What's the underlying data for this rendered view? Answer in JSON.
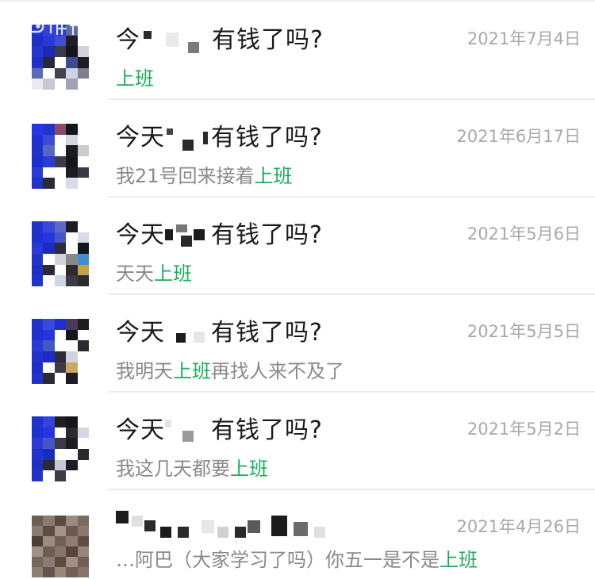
{
  "watermark": {
    "icon": "game-watermark-logo"
  },
  "colors": {
    "keyword": "#1aad5b",
    "date": "#a8a8a8",
    "preview": "#8a8a8a",
    "title": "#1a1a1a"
  },
  "chats": [
    {
      "title_start": "今",
      "title_end": "有钱了吗?",
      "date": "2021年7月4日",
      "preview_before": "",
      "preview_keyword": "上班",
      "preview_after": ""
    },
    {
      "title_start": "今天",
      "title_end": "有钱了吗?",
      "date": "2021年6月17日",
      "preview_before": "我21号回来接着",
      "preview_keyword": "上班",
      "preview_after": ""
    },
    {
      "title_start": "今天",
      "title_end": "有钱了吗?",
      "date": "2021年5月6日",
      "preview_before": "天天",
      "preview_keyword": "上班",
      "preview_after": ""
    },
    {
      "title_start": "今天",
      "title_end": "有钱了吗?",
      "date": "2021年5月5日",
      "preview_before": "我明天",
      "preview_keyword": "上班",
      "preview_after": "再找人来不及了"
    },
    {
      "title_start": "今天",
      "title_end": "有钱了吗?",
      "date": "2021年5月2日",
      "preview_before": "我这几天都要",
      "preview_keyword": "上班",
      "preview_after": ""
    },
    {
      "title_start": "",
      "title_end": "",
      "date": "2021年4月26日",
      "preview_before": "…阿巴（大家学习了吗）你五一是不是",
      "preview_keyword": "上班",
      "preview_after": ""
    }
  ]
}
